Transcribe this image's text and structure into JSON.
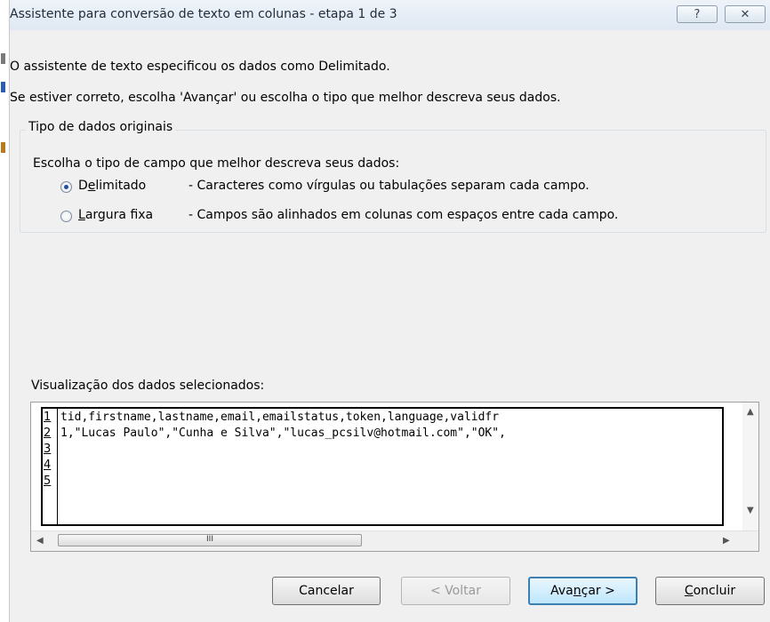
{
  "window": {
    "title": "Assistente para conversão de texto em colunas - etapa 1 de 3",
    "help_glyph": "?",
    "close_glyph": "✕"
  },
  "intro": {
    "line1": "O assistente de texto especificou os dados como Delimitado.",
    "line2": "Se estiver correto, escolha 'Avançar' ou escolha o tipo que melhor descreva seus dados."
  },
  "group": {
    "legend": "Tipo de dados originais",
    "prompt": "Escolha o tipo de campo que melhor descreva seus dados:",
    "options": [
      {
        "label_pre": "D",
        "label_u": "e",
        "label_post": "limitado",
        "description": "- Caracteres como vírgulas ou tabulações separam cada campo.",
        "selected": true
      },
      {
        "label_pre": "",
        "label_u": "L",
        "label_post": "argura fixa",
        "description": "- Campos são alinhados em colunas com espaços entre cada campo.",
        "selected": false
      }
    ]
  },
  "preview": {
    "label": "Visualização dos dados selecionados:",
    "rows": [
      {
        "num": "1",
        "text": "tid,firstname,lastname,email,emailstatus,token,language,validfr"
      },
      {
        "num": "2",
        "text": "1,\"Lucas Paulo\",\"Cunha e Silva\",\"lucas_pcsilv@hotmail.com\",\"OK\","
      },
      {
        "num": "3",
        "text": ""
      },
      {
        "num": "4",
        "text": ""
      },
      {
        "num": "5",
        "text": ""
      }
    ],
    "scroll": {
      "up": "▲",
      "down": "▼",
      "left": "◀",
      "right": "▶",
      "thumb_grip": "III"
    }
  },
  "buttons": {
    "cancel": "Cancelar",
    "back": "< Voltar",
    "next_pre": "Ava",
    "next_u": "n",
    "next_post": "çar >",
    "finish_u": "C",
    "finish_post": "oncluir"
  },
  "colors": {
    "dialog_bg": "#f0f0f0",
    "radio_dot": "#1f4fa8",
    "default_button_border": "#3c7fb1"
  }
}
